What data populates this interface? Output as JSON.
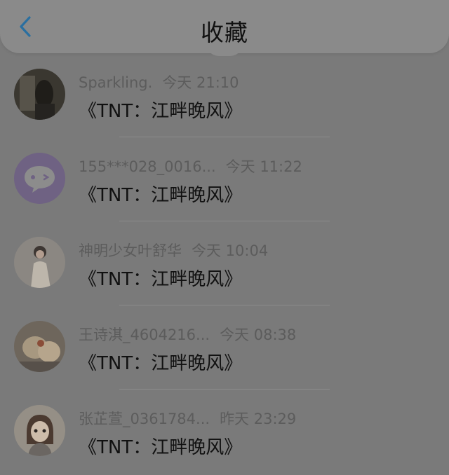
{
  "header": {
    "title": "收藏"
  },
  "items": [
    {
      "user": "Sparkling.",
      "time": "今天 21:10",
      "title": "《TNT：江畔晚风》"
    },
    {
      "user": "155***028_0016...",
      "time": "今天 11:22",
      "title": "《TNT：江畔晚风》"
    },
    {
      "user": "神明少女叶舒华",
      "time": "今天 10:04",
      "title": "《TNT：江畔晚风》"
    },
    {
      "user": "王诗淇_4604216...",
      "time": "今天 08:38",
      "title": "《TNT：江畔晚风》"
    },
    {
      "user": "张芷萱_0361784...",
      "time": "昨天 23:29",
      "title": "《TNT：江畔晚风》"
    }
  ],
  "colors": {
    "accent": "#2a8fd6",
    "overlay_bg": "#7a7a7a"
  }
}
